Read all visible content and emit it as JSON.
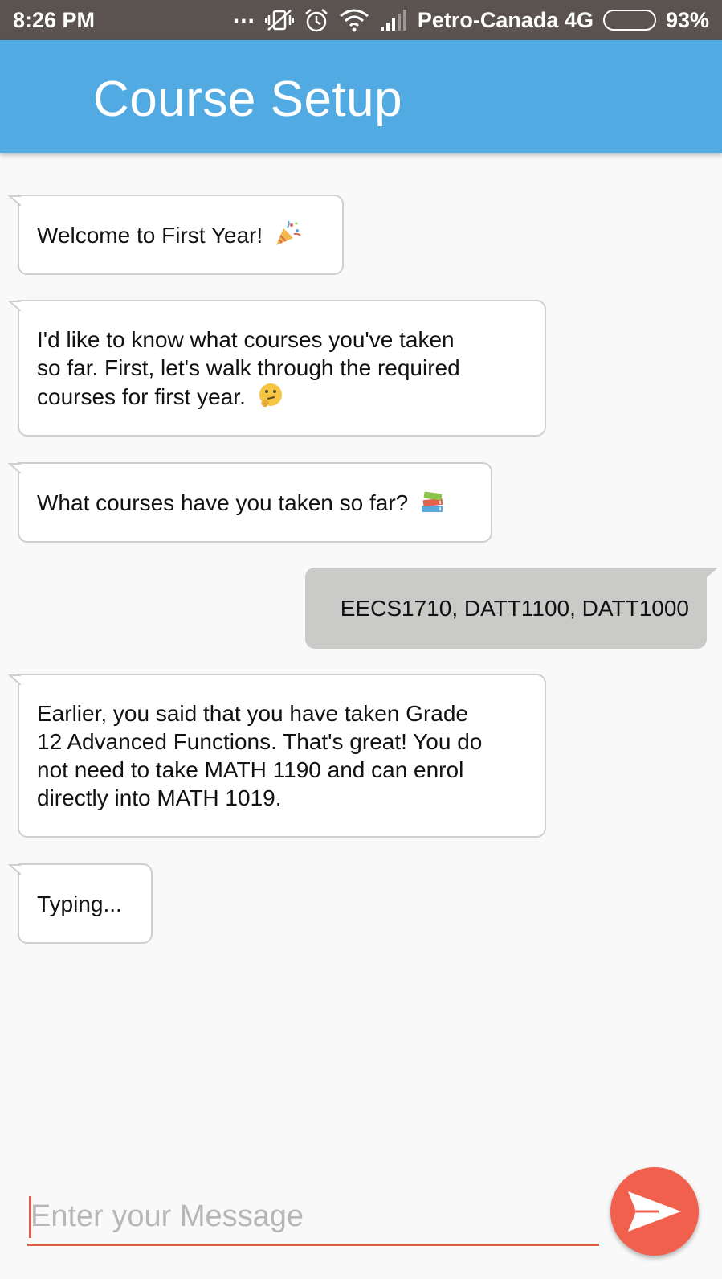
{
  "status_bar": {
    "time": "8:26 PM",
    "dots": "...",
    "carrier": "Petro-Canada 4G",
    "battery": "93%",
    "battery_level": 0.93
  },
  "app_bar": {
    "title": "Course Setup"
  },
  "messages": [
    {
      "from": "bot",
      "text": "Welcome to First Year!",
      "emoji": "party-popper-icon"
    },
    {
      "from": "bot",
      "lines": [
        "I'd like to know what courses you've taken",
        "so far. First, let's walk through the required",
        "courses for first year."
      ],
      "emoji": "thinking-face-icon"
    },
    {
      "from": "bot",
      "text": "What courses have you taken so far?",
      "emoji": "books-icon"
    },
    {
      "from": "user",
      "text": "EECS1710, DATT1100, DATT1000"
    },
    {
      "from": "bot",
      "lines": [
        "Earlier, you said that you have taken Grade",
        "12 Advanced Functions. That's great! You do",
        "not need to take MATH 1190 and can enrol",
        "directly into MATH 1019."
      ]
    },
    {
      "from": "bot",
      "text": "Typing..."
    }
  ],
  "composer": {
    "placeholder": "Enter your Message",
    "value": "",
    "send_icon": "send-icon",
    "accent": "#f0604c"
  },
  "colors": {
    "app_bar": "#51aae2",
    "status_bar": "#5a534f",
    "user_bubble": "#cacac8",
    "bot_bubble": "#ffffff"
  }
}
